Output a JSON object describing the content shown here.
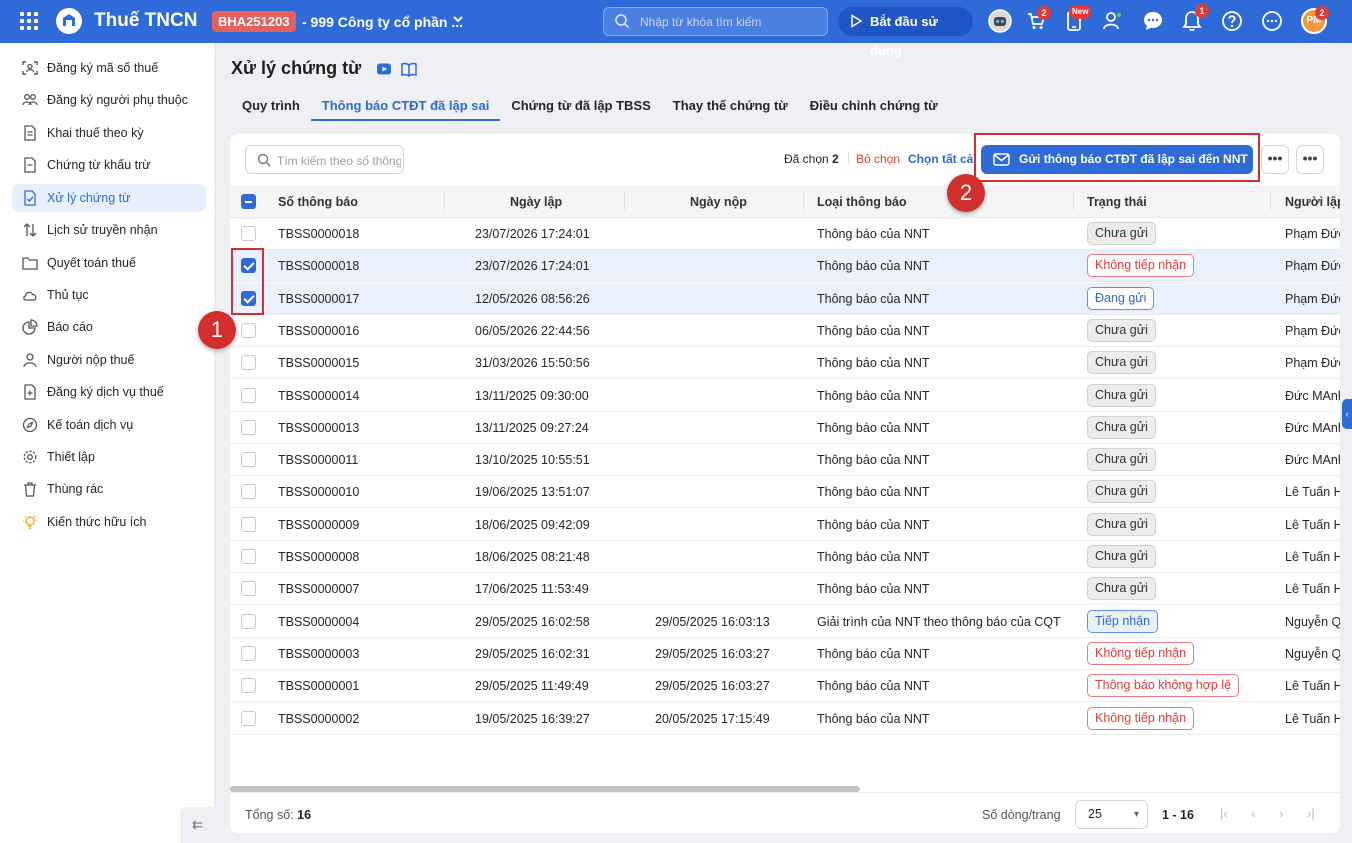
{
  "topbar": {
    "app_title": "Thuế TNCN",
    "org_code": "BHA251203",
    "org_name": "- 999 Công ty cổ phần ...",
    "search_placeholder": "Nhập từ khóa tìm kiếm",
    "start_label": "Bắt đầu sử dụng",
    "cart_badge": "2",
    "new_badge": "New",
    "bell_badge": "1",
    "avatar_initials": "PM",
    "avatar_badge": "2",
    "icons": [
      "grid-icon",
      "app-logo",
      "search-icon",
      "play-icon",
      "robot-icon",
      "cart-icon",
      "mobile-icon",
      "user-add-icon",
      "chat-icon",
      "bell-icon",
      "help-icon",
      "more-icon"
    ]
  },
  "sidebar": {
    "items": [
      {
        "label": "Đăng ký mã số thuế",
        "icon": "id-scan-icon"
      },
      {
        "label": "Đăng ký người phụ thuộc",
        "icon": "people-icon"
      },
      {
        "label": "Khai thuế theo kỳ",
        "icon": "file-icon"
      },
      {
        "label": "Chứng từ khấu trừ",
        "icon": "document-icon"
      },
      {
        "label": "Xử lý chứng từ",
        "icon": "file-check-icon",
        "active": true
      },
      {
        "label": "Lịch sử truyền nhận",
        "icon": "transfer-icon"
      },
      {
        "label": "Quyết toán thuế",
        "icon": "folder-icon"
      },
      {
        "label": "Thủ tục",
        "icon": "cloud-icon"
      },
      {
        "label": "Báo cáo",
        "icon": "pie-chart-icon"
      },
      {
        "label": "Người nộp thuế",
        "icon": "user-icon"
      },
      {
        "label": "Đăng ký dịch vụ thuế",
        "icon": "file-plus-icon"
      },
      {
        "label": "Kế toán dịch vụ",
        "icon": "compass-icon"
      },
      {
        "label": "Thiết lập",
        "icon": "gear-icon"
      },
      {
        "label": "Thùng rác",
        "icon": "trash-icon"
      },
      {
        "label": "Kiến thức hữu ích",
        "icon": "lightbulb-icon"
      }
    ],
    "collapse_glyph": "⇇"
  },
  "page": {
    "title": "Xử lý chứng từ",
    "tabs": [
      "Quy trình",
      "Thông báo CTĐT đã lập sai",
      "Chứng từ đã lập TBSS",
      "Thay thế chứng từ",
      "Điều chỉnh chứng từ"
    ],
    "active_tab": 1
  },
  "toolbar": {
    "search_placeholder": "Tìm kiếm theo số thông báo",
    "selected_label": "Đã chọn",
    "selected_count": "2",
    "deselect_label": "Bỏ chọn",
    "select_all_label": "Chọn tất cả",
    "send_label": "Gửi thông báo CTĐT đã lập sai đến NNT",
    "more_glyph": "•••"
  },
  "table": {
    "columns": [
      "Số thông báo",
      "Ngày lập",
      "Ngày nộp",
      "Loại thông báo",
      "Trạng thái",
      "Người lập"
    ],
    "rows": [
      {
        "so": "TBSS0000018",
        "ngay_lap": "23/07/2026 17:24:01",
        "ngay_nop": "",
        "loai": "Thông báo của NNT",
        "trang_thai": "Chưa gửi",
        "status_style": "grey",
        "nguoi_lap": "Phạm Đức",
        "checked": false
      },
      {
        "so": "TBSS0000018",
        "ngay_lap": "23/07/2026 17:24:01",
        "ngay_nop": "",
        "loai": "Thông báo của NNT",
        "trang_thai": "Không tiếp nhận",
        "status_style": "red",
        "nguoi_lap": "Phạm Đức",
        "checked": true
      },
      {
        "so": "TBSS0000017",
        "ngay_lap": "12/05/2026 08:56:26",
        "ngay_nop": "",
        "loai": "Thông báo của NNT",
        "trang_thai": "Đang gửi",
        "status_style": "blue",
        "nguoi_lap": "Phạm Đức",
        "checked": true
      },
      {
        "so": "TBSS0000016",
        "ngay_lap": "06/05/2026 22:44:56",
        "ngay_nop": "",
        "loai": "Thông báo của NNT",
        "trang_thai": "Chưa gửi",
        "status_style": "grey",
        "nguoi_lap": "Phạm Đức",
        "checked": false
      },
      {
        "so": "TBSS0000015",
        "ngay_lap": "31/03/2026 15:50:56",
        "ngay_nop": "",
        "loai": "Thông báo của NNT",
        "trang_thai": "Chưa gửi",
        "status_style": "grey",
        "nguoi_lap": "Phạm Đức",
        "checked": false
      },
      {
        "so": "TBSS0000014",
        "ngay_lap": "13/11/2025 09:30:00",
        "ngay_nop": "",
        "loai": "Thông báo của NNT",
        "trang_thai": "Chưa gửi",
        "status_style": "grey",
        "nguoi_lap": "Đức MAnh",
        "checked": false
      },
      {
        "so": "TBSS0000013",
        "ngay_lap": "13/11/2025 09:27:24",
        "ngay_nop": "",
        "loai": "Thông báo của NNT",
        "trang_thai": "Chưa gửi",
        "status_style": "grey",
        "nguoi_lap": "Đức MAnh",
        "checked": false
      },
      {
        "so": "TBSS0000011",
        "ngay_lap": "13/10/2025 10:55:51",
        "ngay_nop": "",
        "loai": "Thông báo của NNT",
        "trang_thai": "Chưa gửi",
        "status_style": "grey",
        "nguoi_lap": "Đức MAnh",
        "checked": false
      },
      {
        "so": "TBSS0000010",
        "ngay_lap": "19/06/2025 13:51:07",
        "ngay_nop": "",
        "loai": "Thông báo của NNT",
        "trang_thai": "Chưa gửi",
        "status_style": "grey",
        "nguoi_lap": "Lê Tuấn H",
        "checked": false
      },
      {
        "so": "TBSS0000009",
        "ngay_lap": "18/06/2025 09:42:09",
        "ngay_nop": "",
        "loai": "Thông báo của NNT",
        "trang_thai": "Chưa gửi",
        "status_style": "grey",
        "nguoi_lap": "Lê Tuấn H",
        "checked": false
      },
      {
        "so": "TBSS0000008",
        "ngay_lap": "18/06/2025 08:21:48",
        "ngay_nop": "",
        "loai": "Thông báo của NNT",
        "trang_thai": "Chưa gửi",
        "status_style": "grey",
        "nguoi_lap": "Lê Tuấn H",
        "checked": false
      },
      {
        "so": "TBSS0000007",
        "ngay_lap": "17/06/2025 11:53:49",
        "ngay_nop": "",
        "loai": "Thông báo của NNT",
        "trang_thai": "Chưa gửi",
        "status_style": "grey",
        "nguoi_lap": "Lê Tuấn H",
        "checked": false
      },
      {
        "so": "TBSS0000004",
        "ngay_lap": "29/05/2025 16:02:58",
        "ngay_nop": "29/05/2025 16:03:13",
        "loai": "Giải trình của NNT theo thông báo của CQT",
        "trang_thai": "Tiếp nhận",
        "status_style": "blue2",
        "nguoi_lap": "Nguyễn Q",
        "checked": false
      },
      {
        "so": "TBSS0000003",
        "ngay_lap": "29/05/2025 16:02:31",
        "ngay_nop": "29/05/2025 16:03:27",
        "loai": "Thông báo của NNT",
        "trang_thai": "Không tiếp nhận",
        "status_style": "red",
        "nguoi_lap": "Nguyễn Q",
        "checked": false
      },
      {
        "so": "TBSS0000001",
        "ngay_lap": "29/05/2025 11:49:49",
        "ngay_nop": "29/05/2025 16:03:27",
        "loai": "Thông báo của NNT",
        "trang_thai": "Thông báo không hợp lệ",
        "status_style": "red",
        "nguoi_lap": "Lê Tuấn H",
        "checked": false
      },
      {
        "so": "TBSS0000002",
        "ngay_lap": "19/05/2025 16:39:27",
        "ngay_nop": "20/05/2025 17:15:49",
        "loai": "Thông báo của NNT",
        "trang_thai": "Không tiếp nhận",
        "status_style": "red",
        "nguoi_lap": "Lê Tuấn H",
        "checked": false
      }
    ]
  },
  "footer": {
    "total_label": "Tổng số:",
    "total_value": "16",
    "rows_per_page_label": "Số dòng/trang",
    "rows_per_page": "25",
    "range": "1 - 16",
    "pager": [
      "|‹",
      "‹",
      "›",
      "›|"
    ]
  },
  "annotations": {
    "step1": "1",
    "step2": "2"
  },
  "colors": {
    "primary": "#2e6bd9",
    "annotation_red": "#d32f2f",
    "status_red": "#e53935"
  }
}
